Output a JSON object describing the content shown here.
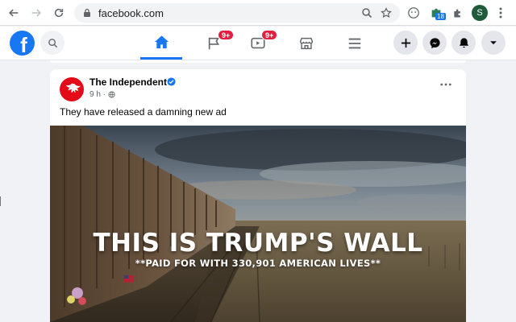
{
  "browser": {
    "url": "facebook.com",
    "extension_badge": "18",
    "profile_initial": "S"
  },
  "fb": {
    "logo_letter": "f",
    "tabs": [
      {
        "name": "home",
        "badge": ""
      },
      {
        "name": "pages",
        "badge": "9+"
      },
      {
        "name": "watch",
        "badge": "9+"
      },
      {
        "name": "marketplace",
        "badge": ""
      },
      {
        "name": "menu",
        "badge": ""
      }
    ]
  },
  "post": {
    "page_name": "The Independent",
    "time": "9 h ·",
    "caption": "They have released a damning new ad",
    "media_headline": "THIS IS TRUMP'S WALL",
    "media_subline": "**PAID FOR WITH 330,901 AMERICAN LIVES**"
  },
  "colors": {
    "fb_blue": "#1877f2",
    "badge_red": "#e41e3f",
    "independent_red": "#e30b17"
  }
}
